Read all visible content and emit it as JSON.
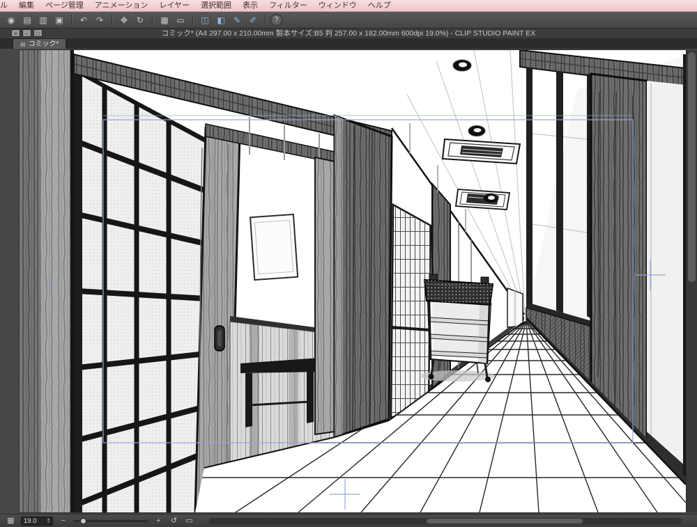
{
  "window": {
    "title": "コミック* (A4 297.00 x 210.00mm 製本サイズ:B5 判 257.00 x 182.00mm 600dpi 19.0%) - CLIP STUDIO PAINT EX"
  },
  "menu": {
    "items": [
      {
        "label": "ル"
      },
      {
        "label": "編集"
      },
      {
        "label": "ページ管理"
      },
      {
        "label": "アニメーション"
      },
      {
        "label": "レイヤー"
      },
      {
        "label": "選択範囲"
      },
      {
        "label": "表示"
      },
      {
        "label": "フィルター"
      },
      {
        "label": "ウィンドウ"
      },
      {
        "label": "ヘルプ"
      }
    ]
  },
  "toolbar": {
    "icons": [
      {
        "name": "app-logo",
        "glyph": "◉"
      },
      {
        "name": "new-canvas",
        "glyph": "▤"
      },
      {
        "name": "open-file",
        "glyph": "▥"
      },
      {
        "name": "save-file",
        "glyph": "▣"
      },
      {
        "name": "undo",
        "glyph": "↶"
      },
      {
        "name": "redo",
        "glyph": "↷"
      },
      {
        "name": "transform",
        "glyph": "✥"
      },
      {
        "name": "rotate-view",
        "glyph": "↻"
      },
      {
        "name": "grid",
        "glyph": "▦"
      },
      {
        "name": "selection",
        "glyph": "▭"
      },
      {
        "name": "snap-ruler",
        "glyph": "◫"
      },
      {
        "name": "snap-special",
        "glyph": "◧"
      },
      {
        "name": "pen-tool",
        "glyph": "✎"
      },
      {
        "name": "pen-settings",
        "glyph": "✐"
      },
      {
        "name": "help",
        "glyph": "?"
      }
    ]
  },
  "title_bar": {
    "controls": [
      {
        "name": "close",
        "glyph": "×"
      },
      {
        "name": "minimize",
        "glyph": "−"
      },
      {
        "name": "restore",
        "glyph": "□"
      }
    ]
  },
  "tab": {
    "icon_glyph": "▤",
    "label": "コミック*"
  },
  "status_bar": {
    "navigator_glyph": "▦",
    "zoom_value": "19.0",
    "stepper_up": "▲",
    "stepper_down": "▼",
    "zoom_out_glyph": "−",
    "zoom_in_glyph": "+",
    "rotate_reset_glyph": "↺",
    "fit_glyph": "▭"
  },
  "colors": {
    "menu_bar_pink": "#f2cdcd",
    "chrome_gray": "#464646",
    "canvas_white": "#ffffff",
    "guide_blue": "#97a5d8",
    "artwork_ink": "#111111"
  }
}
